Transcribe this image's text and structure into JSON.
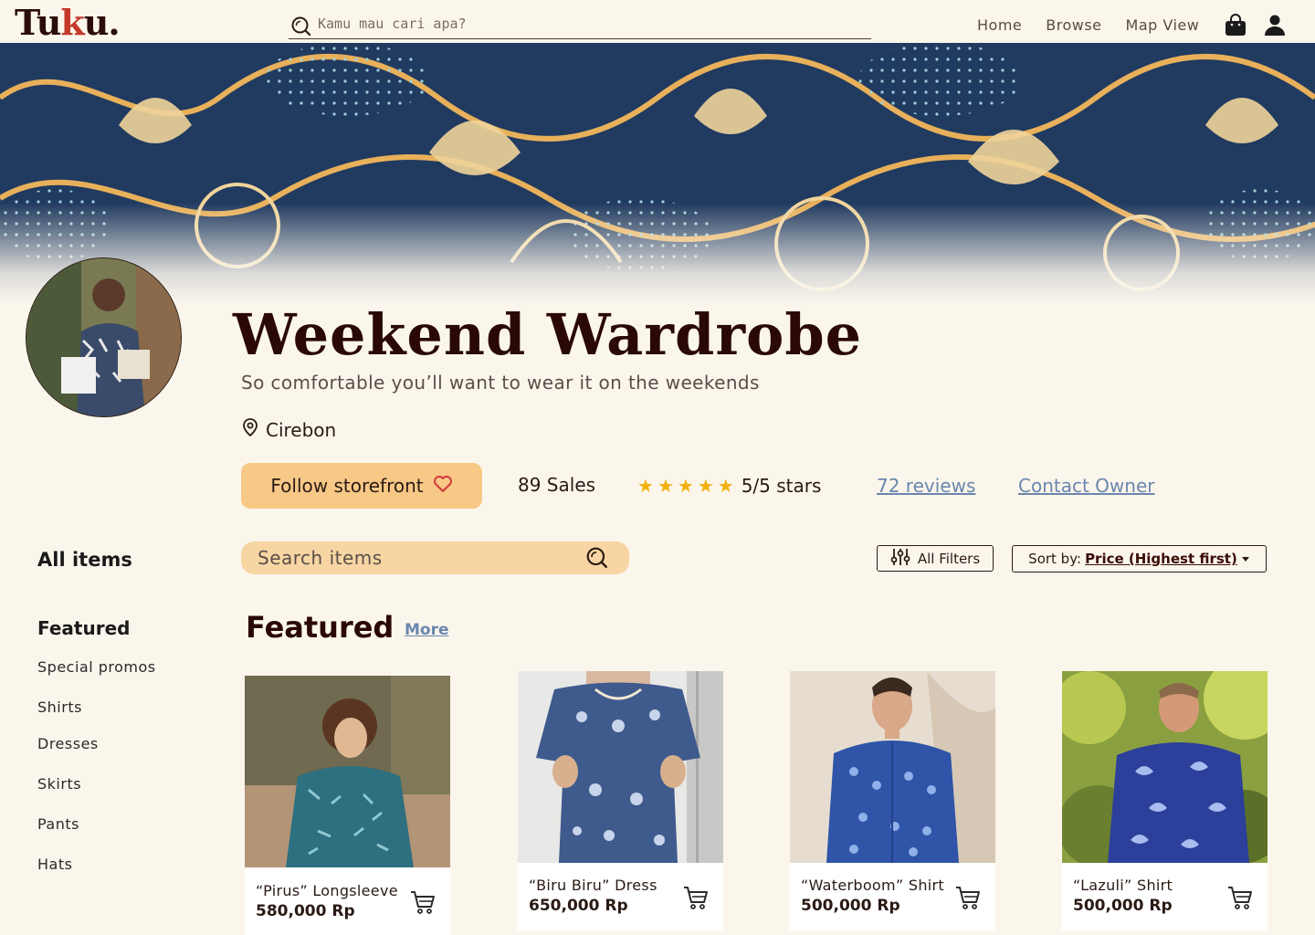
{
  "brand": {
    "logo_left": "Tu",
    "logo_accent": "k",
    "logo_right": "u."
  },
  "topnav": {
    "search_placeholder": "Kamu mau cari apa?",
    "links": [
      "Home",
      "Browse",
      "Map View"
    ]
  },
  "store": {
    "name": "Weekend Wardrobe",
    "tagline": "So comfortable you’ll want to wear it on the weekends",
    "location": "Cirebon",
    "follow_label": "Follow storefront",
    "sales": "89 Sales",
    "rating": 5,
    "rating_label": "5/5 stars",
    "reviews_link": "72 reviews",
    "contact_link": "Contact Owner"
  },
  "sidebar": {
    "heading": "All items",
    "section": "Featured",
    "items": [
      "Special promos",
      "Shirts",
      "Dresses",
      "Skirts",
      "Pants",
      "Hats"
    ]
  },
  "toolbar": {
    "search_placeholder": "Search items",
    "filters_label": "All Filters",
    "sort_prefix": "Sort by:",
    "sort_value": "Price (Highest first)"
  },
  "featured": {
    "title": "Featured",
    "more_label": "More",
    "products": [
      {
        "name": "“Pirus” Longsleeve",
        "price": "580,000 Rp"
      },
      {
        "name": "“Biru Biru” Dress",
        "price": "650,000 Rp"
      },
      {
        "name": "“Waterboom” Shirt",
        "price": "500,000 Rp"
      },
      {
        "name": "“Lazuli” Shirt",
        "price": "500,000 Rp"
      }
    ]
  },
  "colors": {
    "background": "#fbf6ec",
    "accent_button": "#f7c886",
    "search_field": "#f7d6a4",
    "link": "#6a86ae",
    "star": "#f1b10c",
    "title": "#2a0806"
  },
  "icons": [
    "search-icon",
    "shopping-bag-icon",
    "user-icon",
    "location-pin-icon",
    "heart-icon",
    "star-icon",
    "filter-sliders-icon",
    "caret-down-icon",
    "cart-icon"
  ]
}
